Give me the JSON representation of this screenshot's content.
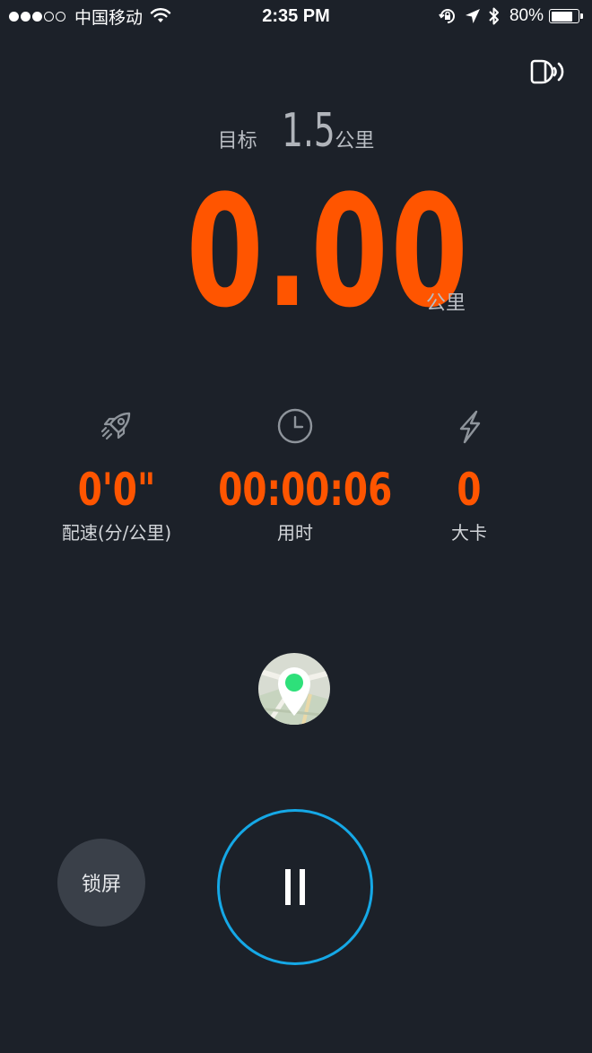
{
  "status_bar": {
    "carrier": "中国移动",
    "time": "2:35 PM",
    "battery_percent": "80%",
    "battery_level": 0.8,
    "signal_bars_filled": 3,
    "signal_bars_total": 5,
    "icons": [
      "wifi-icon",
      "rotation-lock-icon",
      "location-arrow-icon",
      "bluetooth-icon",
      "battery-icon"
    ]
  },
  "header": {
    "voice_icon": "voice-broadcast-icon"
  },
  "goal": {
    "label": "目标",
    "value": "1.5",
    "unit": "公里"
  },
  "distance": {
    "value": "0.00",
    "unit": "公里"
  },
  "stats": [
    {
      "icon": "rocket-icon",
      "value": "0'0\"",
      "label": "配速(分/公里)"
    },
    {
      "icon": "clock-icon",
      "value": "00:00:06",
      "label": "用时"
    },
    {
      "icon": "lightning-icon",
      "value": "0",
      "label": "大卡"
    }
  ],
  "controls": {
    "lock_label": "锁屏",
    "map_icon": "map-pin-icon",
    "pause_icon": "pause-icon"
  },
  "colors": {
    "background": "#1c2129",
    "accent": "#ff5500",
    "pause_ring": "#15a8e6",
    "muted_text": "#b9bdc3"
  }
}
